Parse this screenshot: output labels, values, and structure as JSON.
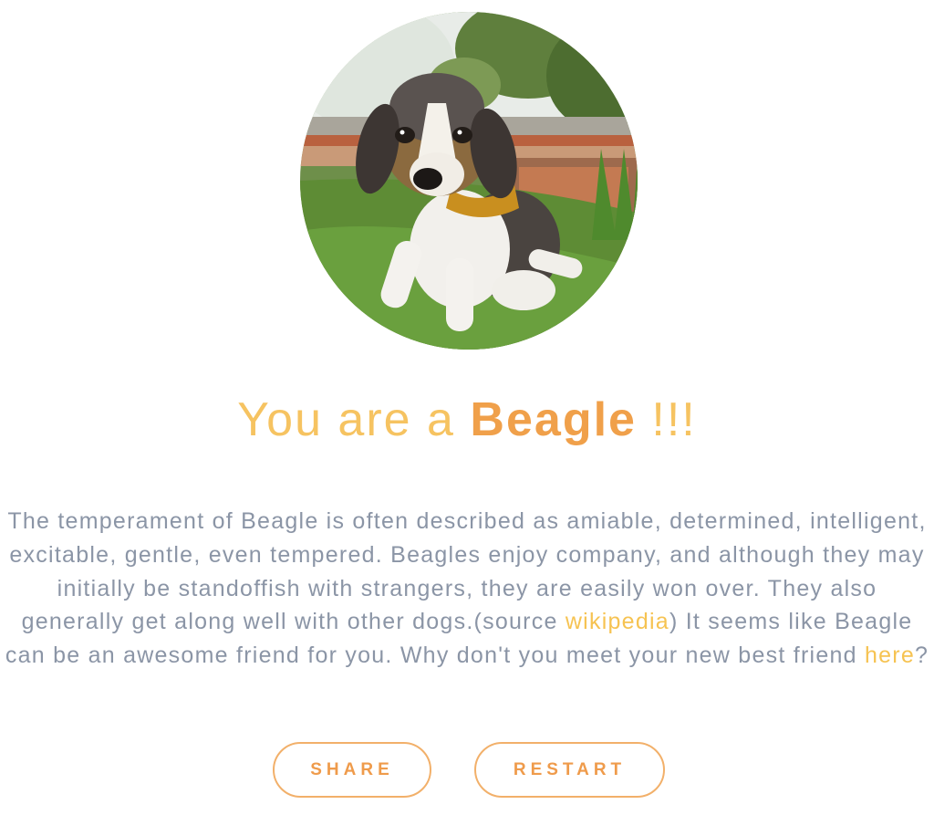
{
  "result": {
    "headline_prefix": "You are a",
    "breed": "Beagle",
    "headline_suffix": "!!!"
  },
  "description": {
    "part1": "The temperament of Beagle is often described as amiable, determined, intelligent, excitable, gentle, even tempered. Beagles enjoy company, and although they may initially be standoffish with strangers, they are easily won over. They also generally get along well with other dogs.(source ",
    "source_link": "wikipedia",
    "part2": ") It seems like Beagle can be an awesome friend for you. Why don't you meet your new best friend ",
    "here_link": "here",
    "part3": "?"
  },
  "buttons": {
    "share": "SHARE",
    "restart": "RESTART"
  },
  "colors": {
    "headline": "#f6c361",
    "breed": "#f0a04a",
    "body_text": "#8b95a6",
    "link": "#f6c352",
    "button_border": "#f2b06a",
    "button_text": "#ef9b4b"
  }
}
